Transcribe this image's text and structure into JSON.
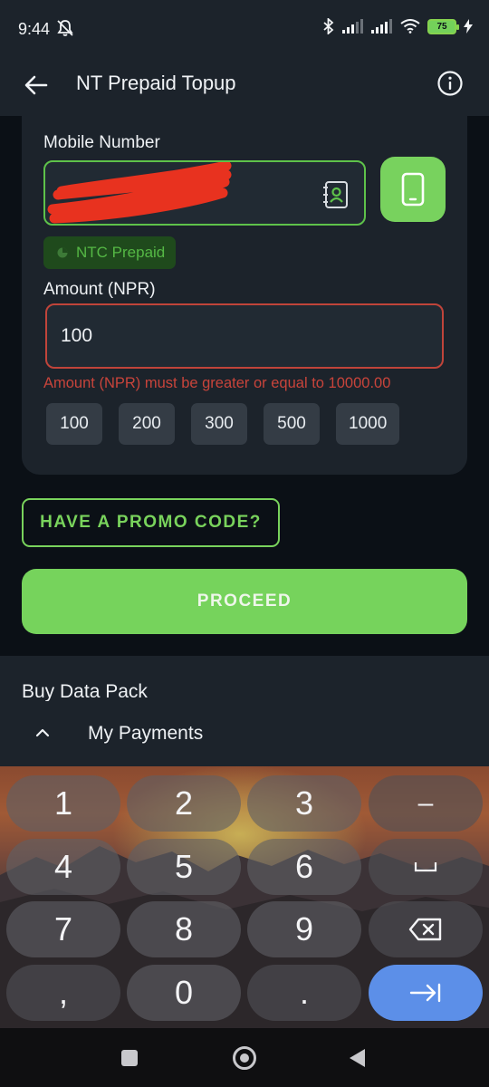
{
  "status_bar": {
    "time": "9:44",
    "battery": "75",
    "icons": [
      "bell-off-icon",
      "bluetooth-icon",
      "signal-icon",
      "signal-icon",
      "wifi-icon",
      "battery-icon",
      "charging-icon"
    ]
  },
  "header": {
    "title": "NT Prepaid Topup",
    "back_icon": "arrow-left-icon",
    "info_icon": "info-icon"
  },
  "form": {
    "mobile_label": "Mobile Number",
    "mobile_value_redacted": true,
    "operator_badge": "NTC Prepaid",
    "amount_label": "Amount (NPR)",
    "amount_value": "100",
    "amount_error": "Amount (NPR) must be greater or equal to 10000.00",
    "quick_amounts": [
      "100",
      "200",
      "300",
      "500",
      "1000"
    ]
  },
  "actions": {
    "promo_label": "HAVE A PROMO CODE?",
    "proceed_label": "PROCEED"
  },
  "lower": {
    "data_pack_title": "Buy Data Pack",
    "payments_label": "My Payments"
  },
  "keyboard": {
    "keys": [
      "1",
      "2",
      "3",
      "–",
      "4",
      "5",
      "6",
      "␣",
      "7",
      "8",
      "9",
      "backspace",
      ",",
      "0",
      ".",
      "next"
    ]
  },
  "colors": {
    "accent_green": "#76d35c",
    "error_red": "#c8443b",
    "surface": "#1c232b",
    "background": "#0b1016"
  }
}
